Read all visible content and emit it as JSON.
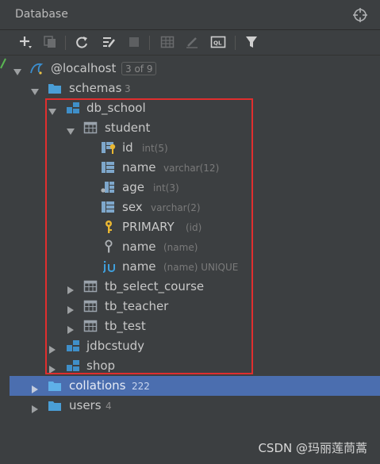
{
  "panel": {
    "title": "Database",
    "settings_icon": "crosshair-gear-icon"
  },
  "toolbar": {
    "buttons": [
      {
        "name": "add-icon"
      },
      {
        "name": "duplicate-icon"
      },
      {
        "name": "refresh-icon"
      },
      {
        "name": "edit-properties-icon"
      },
      {
        "name": "stop-icon"
      },
      {
        "name": "table-view-icon"
      },
      {
        "name": "edit-icon"
      },
      {
        "name": "query-console-icon"
      },
      {
        "name": "filter-icon"
      }
    ]
  },
  "tree": {
    "host": {
      "label": "@localhost",
      "badge": "3 of 9"
    },
    "schemas": {
      "label": "schemas",
      "count": "3"
    },
    "db_school": {
      "label": "db_school"
    },
    "student": {
      "label": "student"
    },
    "columns": [
      {
        "label": "id",
        "type": "int(5)"
      },
      {
        "label": "name",
        "type": "varchar(12)"
      },
      {
        "label": "age",
        "type": "int(3)"
      },
      {
        "label": "sex",
        "type": "varchar(2)"
      }
    ],
    "primary": {
      "label": "PRIMARY",
      "hint": "(id)"
    },
    "index": {
      "label": "name",
      "hint": "(name)"
    },
    "unique": {
      "label": "name",
      "hint": "(name) UNIQUE"
    },
    "tables": [
      {
        "label": "tb_select_course"
      },
      {
        "label": "tb_teacher"
      },
      {
        "label": "tb_test"
      }
    ],
    "jdbcstudy": {
      "label": "jdbcstudy"
    },
    "shop": {
      "label": "shop"
    },
    "collations": {
      "label": "collations",
      "count": "222"
    },
    "users": {
      "label": "users",
      "count": "4"
    }
  },
  "watermark": "CSDN @玛丽莲茼蒿",
  "colors": {
    "selected_row": "#4b6eaf",
    "highlight": "#e02e2e",
    "folder": "#4a9ed6"
  }
}
